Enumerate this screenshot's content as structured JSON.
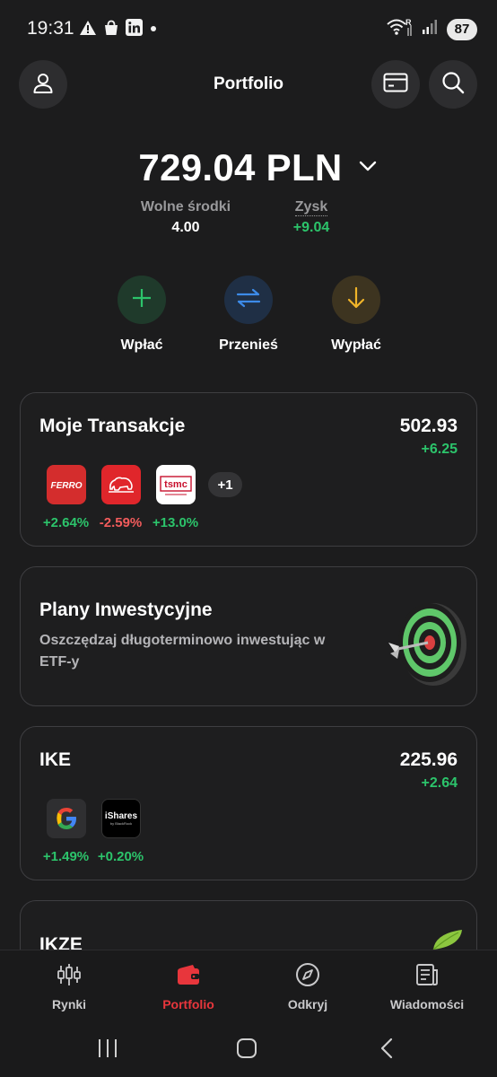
{
  "status": {
    "time": "19:31",
    "battery": "87",
    "icons_left": [
      "warning-icon",
      "shopping-bag-icon",
      "linkedin-icon",
      "dot-icon"
    ],
    "icons_right": [
      "wifi-icon",
      "signal-icon"
    ]
  },
  "header": {
    "title": "Portfolio",
    "left_icon": "profile-icon",
    "right_icons": [
      "card-icon",
      "search-icon"
    ]
  },
  "balance": {
    "value": "729.04 PLN",
    "free_funds_label": "Wolne środki",
    "free_funds_value": "4.00",
    "profit_label": "Zysk",
    "profit_value": "+9.04"
  },
  "actions": [
    {
      "label": "Wpłać",
      "icon": "plus-icon",
      "color": "#2cc46b"
    },
    {
      "label": "Przenieś",
      "icon": "transfer-icon",
      "color": "#3d8be8"
    },
    {
      "label": "Wypłać",
      "icon": "arrow-down-icon",
      "color": "#f0b429"
    }
  ],
  "cards": {
    "transactions": {
      "title": "Moje Transakcje",
      "value": "502.93",
      "change": "+6.25",
      "logos": [
        {
          "name": "FERRO",
          "pct": "+2.64%",
          "positive": true
        },
        {
          "name": "bison-logo",
          "pct": "-2.59%",
          "positive": false
        },
        {
          "name": "tsmc",
          "pct": "+13.0%",
          "positive": true
        }
      ],
      "more": "+1"
    },
    "plans": {
      "title": "Plany Inwestycyjne",
      "description": "Oszczędzaj długoterminowo inwestując w ETF-y"
    },
    "ike": {
      "title": "IKE",
      "value": "225.96",
      "change": "+2.64",
      "logos": [
        {
          "name": "G",
          "pct": "+1.49%",
          "positive": true
        },
        {
          "name": "iShares",
          "sub": "by BlackRock",
          "pct": "+0.20%",
          "positive": true
        }
      ]
    },
    "ikze": {
      "title": "IKZE"
    }
  },
  "bottom_nav": [
    {
      "label": "Rynki",
      "icon": "candlestick-icon",
      "active": false
    },
    {
      "label": "Portfolio",
      "icon": "wallet-icon",
      "active": true
    },
    {
      "label": "Odkryj",
      "icon": "compass-icon",
      "active": false
    },
    {
      "label": "Wiadomości",
      "icon": "news-icon",
      "active": false
    }
  ],
  "colors": {
    "accent": "#e8363c",
    "positive": "#2cc46b",
    "negative": "#f25c5c",
    "background": "#1c1c1d"
  }
}
